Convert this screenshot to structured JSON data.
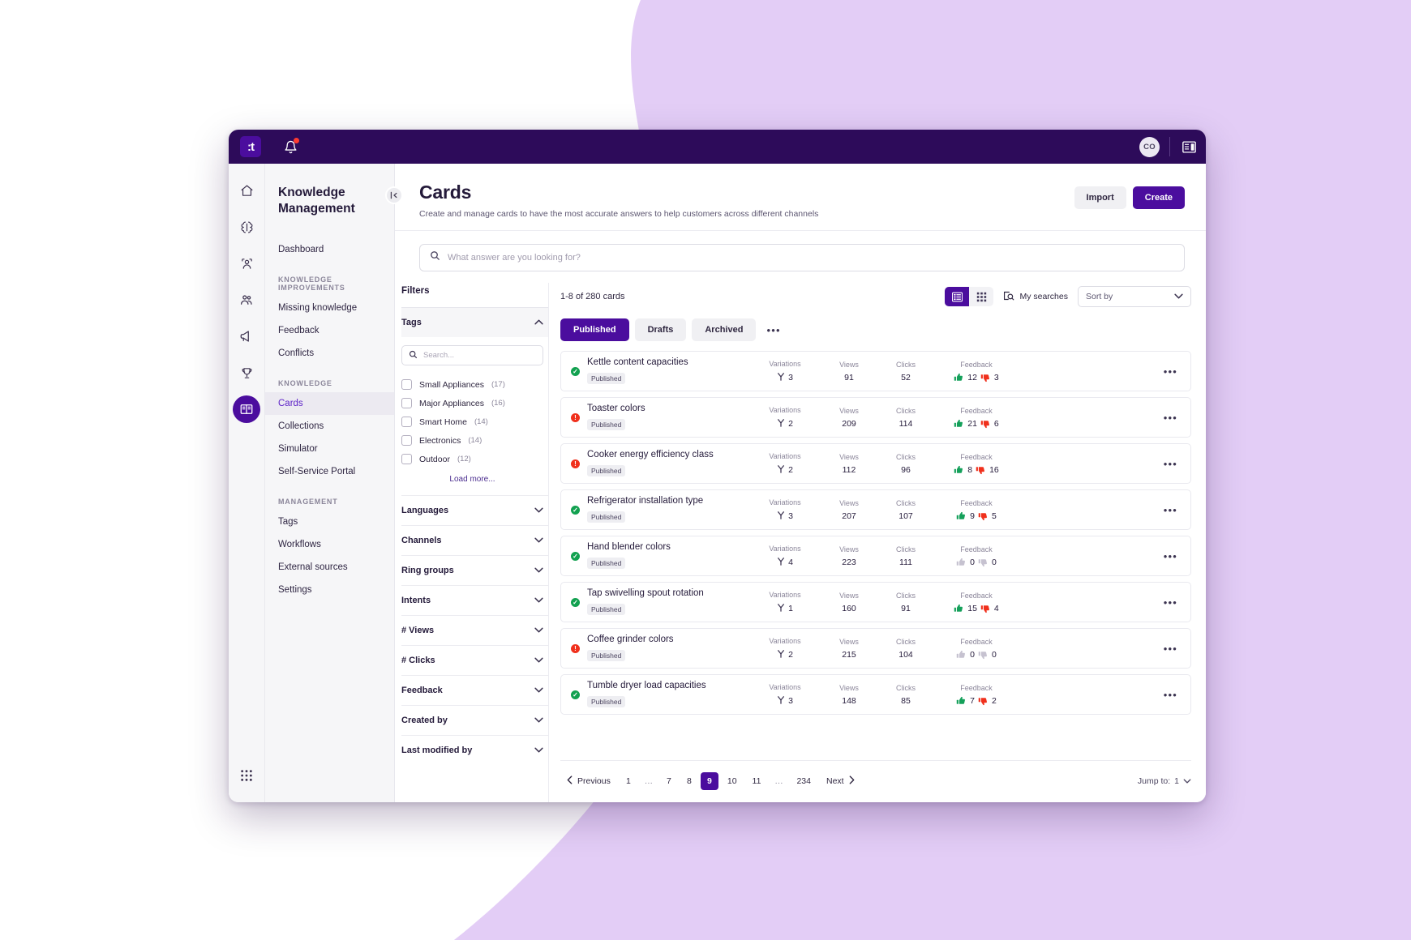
{
  "topbar": {
    "logo_glyph": ":t",
    "logo_name": "app-logo",
    "bell_name": "notifications-bell-icon",
    "avatar_initials": "CO",
    "panel_toggle_name": "panel-layout-icon"
  },
  "rail": {
    "items": [
      {
        "name": "home-icon",
        "label": "Home"
      },
      {
        "name": "brain-icon",
        "label": "AI"
      },
      {
        "name": "agent-icon",
        "label": "Agent"
      },
      {
        "name": "people-icon",
        "label": "People"
      },
      {
        "name": "megaphone-icon",
        "label": "Campaigns"
      },
      {
        "name": "trophy-icon",
        "label": "Gamification"
      },
      {
        "name": "book-icon",
        "label": "Knowledge Management"
      }
    ],
    "bottom_item": {
      "name": "apps-grid-icon",
      "label": "Apps"
    }
  },
  "sidebar": {
    "title": "Knowledge Management",
    "collapse_label": "I<",
    "items": [
      {
        "label": "Dashboard",
        "type": "item",
        "active": false
      },
      {
        "label": "KNOWLEDGE IMPROVEMENTS",
        "type": "group"
      },
      {
        "label": "Missing knowledge",
        "type": "item",
        "active": false
      },
      {
        "label": "Feedback",
        "type": "item",
        "active": false
      },
      {
        "label": "Conflicts",
        "type": "item",
        "active": false
      },
      {
        "label": "KNOWLEDGE",
        "type": "group"
      },
      {
        "label": "Cards",
        "type": "item",
        "active": true
      },
      {
        "label": "Collections",
        "type": "item",
        "active": false
      },
      {
        "label": "Simulator",
        "type": "item",
        "active": false
      },
      {
        "label": "Self-Service Portal",
        "type": "item",
        "active": false
      },
      {
        "label": "MANAGEMENT",
        "type": "group"
      },
      {
        "label": "Tags",
        "type": "item",
        "active": false
      },
      {
        "label": "Workflows",
        "type": "item",
        "active": false
      },
      {
        "label": "External sources",
        "type": "item",
        "active": false
      },
      {
        "label": "Settings",
        "type": "item",
        "active": false
      }
    ]
  },
  "page": {
    "title": "Cards",
    "subtitle": "Create and manage cards to have the most accurate answers to help customers across different channels",
    "import_label": "Import",
    "create_label": "Create"
  },
  "search": {
    "placeholder": "What answer are you looking for?",
    "value": ""
  },
  "filters": {
    "title": "Filters",
    "tags": {
      "label": "Tags",
      "expanded": true,
      "search_placeholder": "Search...",
      "search_value": "",
      "options": [
        {
          "label": "Small Appliances",
          "count": "(17)",
          "checked": false
        },
        {
          "label": "Major Appliances",
          "count": "(16)",
          "checked": false
        },
        {
          "label": "Smart Home",
          "count": "(14)",
          "checked": false
        },
        {
          "label": "Electronics",
          "count": "(14)",
          "checked": false
        },
        {
          "label": "Outdoor",
          "count": "(12)",
          "checked": false
        }
      ],
      "load_more": "Load more..."
    },
    "sections": [
      {
        "label": "Languages"
      },
      {
        "label": "Channels"
      },
      {
        "label": "Ring groups"
      },
      {
        "label": "Intents"
      },
      {
        "label": "# Views"
      },
      {
        "label": "# Clicks"
      },
      {
        "label": "Feedback"
      },
      {
        "label": "Created by"
      },
      {
        "label": "Last modified by"
      }
    ]
  },
  "results": {
    "count_text": "1-8 of 280 cards",
    "view_list_name": "list-view-icon",
    "view_grid_name": "grid-view-icon",
    "my_searches_label": "My searches",
    "sort_by_label": "Sort by",
    "tabs": [
      {
        "label": "Published",
        "active": true
      },
      {
        "label": "Drafts",
        "active": false
      },
      {
        "label": "Archived",
        "active": false
      }
    ],
    "tab_more": "•••",
    "columns": {
      "variations": "Variations",
      "views": "Views",
      "clicks": "Clicks",
      "feedback": "Feedback"
    },
    "rows": [
      {
        "status": "ok",
        "title": "Kettle content capacities",
        "badge": "Published",
        "variations": "3",
        "views": "91",
        "clicks": "52",
        "thumbs_up": "12",
        "thumbs_down": "3",
        "muted": false
      },
      {
        "status": "warn",
        "title": "Toaster colors",
        "badge": "Published",
        "variations": "2",
        "views": "209",
        "clicks": "114",
        "thumbs_up": "21",
        "thumbs_down": "6",
        "muted": false
      },
      {
        "status": "warn",
        "title": "Cooker energy efficiency class",
        "badge": "Published",
        "variations": "2",
        "views": "112",
        "clicks": "96",
        "thumbs_up": "8",
        "thumbs_down": "16",
        "muted": false
      },
      {
        "status": "ok",
        "title": "Refrigerator installation type",
        "badge": "Published",
        "variations": "3",
        "views": "207",
        "clicks": "107",
        "thumbs_up": "9",
        "thumbs_down": "5",
        "muted": false
      },
      {
        "status": "ok",
        "title": "Hand blender colors",
        "badge": "Published",
        "variations": "4",
        "views": "223",
        "clicks": "111",
        "thumbs_up": "0",
        "thumbs_down": "0",
        "muted": true
      },
      {
        "status": "ok",
        "title": "Tap swivelling spout rotation",
        "badge": "Published",
        "variations": "1",
        "views": "160",
        "clicks": "91",
        "thumbs_up": "15",
        "thumbs_down": "4",
        "muted": false
      },
      {
        "status": "warn",
        "title": "Coffee grinder colors",
        "badge": "Published",
        "variations": "2",
        "views": "215",
        "clicks": "104",
        "thumbs_up": "0",
        "thumbs_down": "0",
        "muted": true
      },
      {
        "status": "ok",
        "title": "Tumble dryer load capacities",
        "badge": "Published",
        "variations": "3",
        "views": "148",
        "clicks": "85",
        "thumbs_up": "7",
        "thumbs_down": "2",
        "muted": false
      }
    ],
    "row_more": "•••"
  },
  "pagination": {
    "previous": "Previous",
    "next": "Next",
    "pages": [
      "1",
      "…",
      "7",
      "8",
      "9",
      "10",
      "11",
      "…",
      "234"
    ],
    "active_page": "9",
    "jump_to_label": "Jump to:",
    "jump_to_value": "1"
  },
  "colors": {
    "brand_purple": "#4b0d9e",
    "topbar_purple": "#2d0b5a",
    "bg_lavender": "#e3cdf6",
    "status_ok": "#12a150",
    "status_warn": "#f0301c",
    "thumb_up": "#14a05a",
    "thumb_down": "#f0301c",
    "thumb_muted": "#c6c2d0"
  }
}
